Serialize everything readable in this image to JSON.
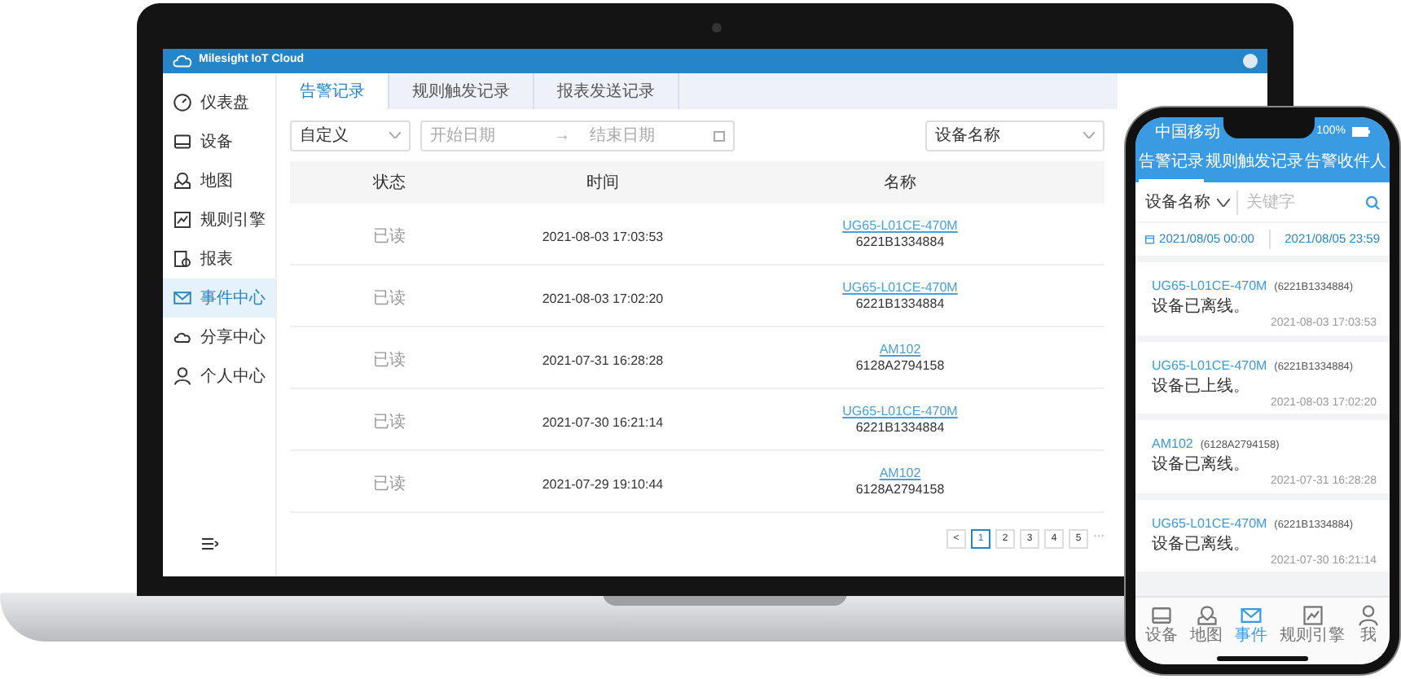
{
  "laptop": {
    "app_title": "Milesight IoT Cloud",
    "sidebar": {
      "items": [
        {
          "label": "仪表盘",
          "kind": "dashboard",
          "selected": false
        },
        {
          "label": "设备",
          "kind": "device",
          "selected": false
        },
        {
          "label": "地图",
          "kind": "map",
          "selected": false
        },
        {
          "label": "规则引擎",
          "kind": "rule",
          "selected": false
        },
        {
          "label": "报表",
          "kind": "report",
          "selected": false
        },
        {
          "label": "事件中心",
          "kind": "mail",
          "selected": true
        },
        {
          "label": "分享中心",
          "kind": "cloud",
          "selected": false
        },
        {
          "label": "个人中心",
          "kind": "user",
          "selected": false
        }
      ]
    },
    "tabs": [
      {
        "label": "告警记录",
        "selected": true
      },
      {
        "label": "规则触发记录",
        "selected": false
      },
      {
        "label": "报表发送记录",
        "selected": false
      }
    ],
    "filters": {
      "range_type": "自定义",
      "start_placeholder": "开始日期",
      "separator": "→",
      "end_placeholder": "结束日期",
      "device_field": "设备名称"
    },
    "table": {
      "columns": [
        "状态",
        "时间",
        "名称"
      ],
      "rows": [
        {
          "status": "已读",
          "time": "2021-08-03 17:03:53",
          "name": "UG65-L01CE-470M",
          "serial": "6221B1334884"
        },
        {
          "status": "已读",
          "time": "2021-08-03 17:02:20",
          "name": "UG65-L01CE-470M",
          "serial": "6221B1334884"
        },
        {
          "status": "已读",
          "time": "2021-07-31 16:28:28",
          "name": "AM102",
          "serial": "6128A2794158"
        },
        {
          "status": "已读",
          "time": "2021-07-30 16:21:14",
          "name": "UG65-L01CE-470M",
          "serial": "6221B1334884"
        },
        {
          "status": "已读",
          "time": "2021-07-29 19:10:44",
          "name": "AM102",
          "serial": "6128A2794158"
        }
      ]
    },
    "pagination": {
      "prev": "<",
      "pages": [
        {
          "label": "1",
          "selected": true
        },
        {
          "label": "2",
          "selected": false
        },
        {
          "label": "3",
          "selected": false
        },
        {
          "label": "4",
          "selected": false
        },
        {
          "label": "5",
          "selected": false
        }
      ],
      "ellipsis": "···"
    }
  },
  "phone": {
    "status_bar": {
      "carrier": "中国移动",
      "battery": "100%"
    },
    "tabs": [
      {
        "label": "告警记录",
        "selected": true
      },
      {
        "label": "规则触发记录",
        "selected": false
      },
      {
        "label": "告警收件人",
        "selected": false
      }
    ],
    "search": {
      "device_select": "设备名称",
      "placeholder": "关键字"
    },
    "date_range": {
      "start": "2021/08/05 00:00",
      "end": "2021/08/05 23:59"
    },
    "events": [
      {
        "name": "UG65-L01CE-470M",
        "serial": "(6221B1334884)",
        "message": "设备已离线。",
        "time": "2021-08-03 17:03:53"
      },
      {
        "name": "UG65-L01CE-470M",
        "serial": "(6221B1334884)",
        "message": "设备已上线。",
        "time": "2021-08-03 17:02:20"
      },
      {
        "name": "AM102",
        "serial": "(6128A2794158)",
        "message": "设备已离线。",
        "time": "2021-07-31 16:28:28"
      },
      {
        "name": "UG65-L01CE-470M",
        "serial": "(6221B1334884)",
        "message": "设备已离线。",
        "time": "2021-07-30 16:21:14"
      }
    ],
    "bottom_nav": [
      {
        "label": "设备",
        "kind": "device",
        "selected": false
      },
      {
        "label": "地图",
        "kind": "map",
        "selected": false
      },
      {
        "label": "事件",
        "kind": "mail",
        "selected": true
      },
      {
        "label": "规则引擎",
        "kind": "rule",
        "selected": false
      },
      {
        "label": "我",
        "kind": "user",
        "selected": false
      }
    ]
  }
}
